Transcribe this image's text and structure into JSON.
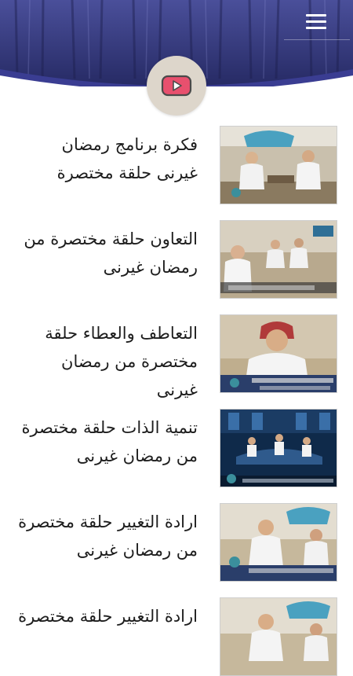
{
  "header": {
    "menu_icon": "hamburger-menu-icon",
    "badge_icon": "youtube-play-icon",
    "colors": {
      "sky_top": "#3b3f8a",
      "sky_bottom": "#2a2d6e",
      "wave": "#3c3f95",
      "badge": "#ddd6cb",
      "play": "#e8506e"
    }
  },
  "videos": [
    {
      "title": "فكرة برنامج رمضان غيرنى حلقة مختصرة",
      "thumb_style": "studio-logo"
    },
    {
      "title": "التعاون حلقة مختصرة من رمضان غيرنى",
      "thumb_style": "studio-wide"
    },
    {
      "title": "التعاطف والعطاء حلقة مختصرة من رمضان غيرنى",
      "thumb_style": "closeup-caption"
    },
    {
      "title": "تنمية الذات حلقة مختصرة من رمضان غيرنى",
      "thumb_style": "blue-stage"
    },
    {
      "title": "ارادة التغيير حلقة مختصرة من رمضان غيرنى",
      "thumb_style": "studio-logo"
    },
    {
      "title": "ارادة التغيير حلقة مختصرة",
      "thumb_style": "studio-logo"
    }
  ]
}
